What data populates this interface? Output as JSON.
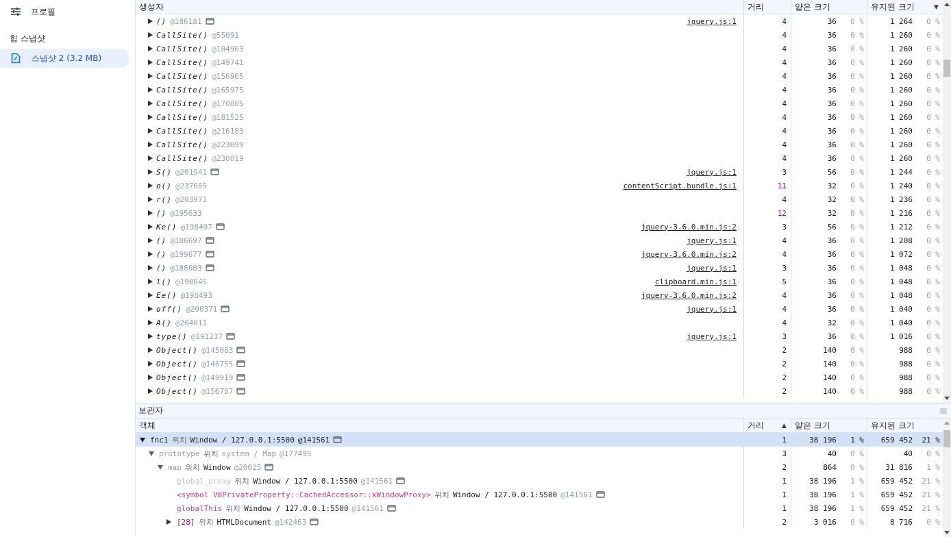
{
  "sidebar": {
    "title": "프로필",
    "section": "힙 스냅샷",
    "items": [
      {
        "label": "스냅샷 2 (3.2 MB)",
        "selected": true
      }
    ]
  },
  "constructors": {
    "columns": [
      {
        "label": "생성자"
      },
      {
        "label": "거리"
      },
      {
        "label": "얕은 크기"
      },
      {
        "label": "유지된 크기",
        "sort_mark": "▼"
      }
    ],
    "rows": [
      {
        "name": "()",
        "id": "@186181",
        "has_icon": true,
        "source": "jquery.js:1",
        "distance": "4",
        "far": false,
        "shallow": "36",
        "shallow_pct": "0 %",
        "retained": "1 264",
        "retained_pct": "0 %",
        "selected": false
      },
      {
        "name": "CallSite()",
        "id": "@55091",
        "has_icon": false,
        "distance": "4",
        "far": false,
        "shallow": "36",
        "shallow_pct": "0 %",
        "retained": "1 260",
        "retained_pct": "0 %",
        "selected": false
      },
      {
        "name": "CallSite()",
        "id": "@104903",
        "has_icon": false,
        "distance": "4",
        "far": false,
        "shallow": "36",
        "shallow_pct": "0 %",
        "retained": "1 260",
        "retained_pct": "0 %",
        "selected": false
      },
      {
        "name": "CallSite()",
        "id": "@149741",
        "has_icon": false,
        "distance": "4",
        "far": false,
        "shallow": "36",
        "shallow_pct": "0 %",
        "retained": "1 260",
        "retained_pct": "0 %",
        "selected": false
      },
      {
        "name": "CallSite()",
        "id": "@156965",
        "has_icon": false,
        "distance": "4",
        "far": false,
        "shallow": "36",
        "shallow_pct": "0 %",
        "retained": "1 260",
        "retained_pct": "0 %",
        "selected": false
      },
      {
        "name": "CallSite()",
        "id": "@165975",
        "has_icon": false,
        "distance": "4",
        "far": false,
        "shallow": "36",
        "shallow_pct": "0 %",
        "retained": "1 260",
        "retained_pct": "0 %",
        "selected": false
      },
      {
        "name": "CallSite()",
        "id": "@170805",
        "has_icon": false,
        "distance": "4",
        "far": false,
        "shallow": "36",
        "shallow_pct": "0 %",
        "retained": "1 260",
        "retained_pct": "0 %",
        "selected": false
      },
      {
        "name": "CallSite()",
        "id": "@181525",
        "has_icon": false,
        "distance": "4",
        "far": false,
        "shallow": "36",
        "shallow_pct": "0 %",
        "retained": "1 260",
        "retained_pct": "0 %",
        "selected": false
      },
      {
        "name": "CallSite()",
        "id": "@216183",
        "has_icon": false,
        "distance": "4",
        "far": false,
        "shallow": "36",
        "shallow_pct": "0 %",
        "retained": "1 260",
        "retained_pct": "0 %",
        "selected": false
      },
      {
        "name": "CallSite()",
        "id": "@223099",
        "has_icon": false,
        "distance": "4",
        "far": false,
        "shallow": "36",
        "shallow_pct": "0 %",
        "retained": "1 260",
        "retained_pct": "0 %",
        "selected": false
      },
      {
        "name": "CallSite()",
        "id": "@230019",
        "has_icon": false,
        "distance": "4",
        "far": false,
        "shallow": "36",
        "shallow_pct": "0 %",
        "retained": "1 260",
        "retained_pct": "0 %",
        "selected": false
      },
      {
        "name": "S()",
        "id": "@201941",
        "has_icon": true,
        "source": "jquery.js:1",
        "distance": "3",
        "far": false,
        "shallow": "56",
        "shallow_pct": "0 %",
        "retained": "1 244",
        "retained_pct": "0 %",
        "selected": false
      },
      {
        "name": "o()",
        "id": "@237665",
        "has_icon": false,
        "source": "contentScript.bundle.js:1",
        "distance": "11",
        "far": true,
        "shallow": "32",
        "shallow_pct": "0 %",
        "retained": "1 240",
        "retained_pct": "0 %",
        "selected": false
      },
      {
        "name": "r()",
        "id": "@203971",
        "has_icon": false,
        "distance": "4",
        "far": false,
        "shallow": "32",
        "shallow_pct": "0 %",
        "retained": "1 236",
        "retained_pct": "0 %",
        "selected": false
      },
      {
        "name": "()",
        "id": "@195633",
        "has_icon": false,
        "distance": "12",
        "far": true,
        "shallow": "32",
        "shallow_pct": "0 %",
        "retained": "1 216",
        "retained_pct": "0 %",
        "selected": false
      },
      {
        "name": "Ke()",
        "id": "@198497",
        "has_icon": true,
        "source": "jquery-3.6.0.min.js:2",
        "distance": "3",
        "far": false,
        "shallow": "56",
        "shallow_pct": "0 %",
        "retained": "1 212",
        "retained_pct": "0 %",
        "selected": false
      },
      {
        "name": "()",
        "id": "@186697",
        "has_icon": true,
        "source": "jquery.js:1",
        "distance": "4",
        "far": false,
        "shallow": "36",
        "shallow_pct": "0 %",
        "retained": "1 208",
        "retained_pct": "0 %",
        "selected": false
      },
      {
        "name": "()",
        "id": "@199677",
        "has_icon": true,
        "source": "jquery-3.6.0.min.js:2",
        "distance": "4",
        "far": false,
        "shallow": "36",
        "shallow_pct": "0 %",
        "retained": "1 072",
        "retained_pct": "0 %",
        "selected": false
      },
      {
        "name": "()",
        "id": "@186683",
        "has_icon": true,
        "source": "jquery.js:1",
        "distance": "3",
        "far": false,
        "shallow": "36",
        "shallow_pct": "0 %",
        "retained": "1 048",
        "retained_pct": "0 %",
        "selected": false
      },
      {
        "name": "l()",
        "id": "@198045",
        "has_icon": false,
        "source": "clipboard.min.js:1",
        "distance": "5",
        "far": false,
        "shallow": "36",
        "shallow_pct": "0 %",
        "retained": "1 048",
        "retained_pct": "0 %",
        "selected": false
      },
      {
        "name": "Ee()",
        "id": "@198493",
        "has_icon": false,
        "source": "jquery-3.6.0.min.js:2",
        "distance": "4",
        "far": false,
        "shallow": "36",
        "shallow_pct": "0 %",
        "retained": "1 048",
        "retained_pct": "0 %",
        "selected": false
      },
      {
        "name": "off()",
        "id": "@200371",
        "has_icon": true,
        "source": "jquery.js:1",
        "distance": "4",
        "far": false,
        "shallow": "36",
        "shallow_pct": "0 %",
        "retained": "1 040",
        "retained_pct": "0 %",
        "selected": false
      },
      {
        "name": "A()",
        "id": "@204011",
        "has_icon": false,
        "distance": "4",
        "far": false,
        "shallow": "32",
        "shallow_pct": "0 %",
        "retained": "1 040",
        "retained_pct": "0 %",
        "selected": false
      },
      {
        "name": "type()",
        "id": "@191237",
        "has_icon": true,
        "source": "jquery.js:1",
        "distance": "3",
        "far": false,
        "shallow": "36",
        "shallow_pct": "0 %",
        "retained": "1 016",
        "retained_pct": "0 %",
        "selected": false
      },
      {
        "name": "Object()",
        "id": "@145083",
        "has_icon": true,
        "distance": "2",
        "far": false,
        "shallow": "140",
        "shallow_pct": "0 %",
        "retained": "988",
        "retained_pct": "0 %",
        "selected": false
      },
      {
        "name": "Object()",
        "id": "@146755",
        "has_icon": true,
        "distance": "2",
        "far": false,
        "shallow": "140",
        "shallow_pct": "0 %",
        "retained": "988",
        "retained_pct": "0 %",
        "selected": false
      },
      {
        "name": "Object()",
        "id": "@149919",
        "has_icon": true,
        "distance": "2",
        "far": false,
        "shallow": "140",
        "shallow_pct": "0 %",
        "retained": "988",
        "retained_pct": "0 %",
        "selected": false
      },
      {
        "name": "Object()",
        "id": "@156787",
        "has_icon": true,
        "distance": "2",
        "far": false,
        "shallow": "140",
        "shallow_pct": "0 %",
        "retained": "988",
        "retained_pct": "0 %",
        "selected": false
      }
    ]
  },
  "retainers": {
    "title": "보관자",
    "columns": [
      {
        "label": "객체"
      },
      {
        "label": "거리",
        "sort_mark": "▲"
      },
      {
        "label": "얕은 크기"
      },
      {
        "label": "유지된 크기"
      }
    ],
    "rows": [
      {
        "name": "fnc1",
        "color": "#202124",
        "dimmed": false,
        "in": "위치",
        "class_name": "Window / 127.0.0.1:5500",
        "id": "@141561",
        "has_icon": true,
        "distance": "1",
        "shallow": "38 196",
        "shallow_pct": "1 %",
        "retained": "659 452",
        "retained_pct": "21 %",
        "expanded": true,
        "selected": true,
        "children": [
          {
            "name": "prototype",
            "color": "#9aa0a6",
            "dimmed": true,
            "in": "위치",
            "class_name": "system / Map",
            "id": "@177495",
            "has_icon": false,
            "distance": "3",
            "shallow": "40",
            "shallow_pct": "0 %",
            "retained": "40",
            "retained_pct": "0 %",
            "expanded": true,
            "selected": false,
            "children": [
              {
                "name": "map",
                "color": "#9aa0a6",
                "dimmed": false,
                "in": "위치",
                "class_name": "Window",
                "id": "@20025",
                "has_icon": true,
                "distance": "2",
                "shallow": "864",
                "shallow_pct": "0 %",
                "retained": "31 816",
                "retained_pct": "1 %",
                "expanded": true,
                "selected": false,
                "children": [
                  {
                    "name": "global_proxy",
                    "color": "#bdc1c6",
                    "dimmed": false,
                    "in": "위치",
                    "class_name": "Window / 127.0.0.1:5500",
                    "id": "@141561",
                    "has_icon": true,
                    "distance": "1",
                    "shallow": "38 196",
                    "shallow_pct": "1 %",
                    "retained": "659 452",
                    "retained_pct": "21 %",
                    "selected": false
                  },
                  {
                    "name": "<symbol V8PrivateProperty::CachedAccessor::kWindowProxy>",
                    "color": "#c2477f",
                    "dimmed": false,
                    "in": "위치",
                    "class_name": "Window / 127.0.0.1:5500",
                    "id": "@141561",
                    "has_icon": true,
                    "distance": "1",
                    "shallow": "38 196",
                    "shallow_pct": "1 %",
                    "retained": "659 452",
                    "retained_pct": "21 %",
                    "selected": false
                  },
                  {
                    "name": "globalThis",
                    "color": "#c2477f",
                    "dimmed": false,
                    "in": "위치",
                    "class_name": "Window / 127.0.0.1:5500",
                    "id": "@141561",
                    "has_icon": true,
                    "distance": "1",
                    "shallow": "38 196",
                    "shallow_pct": "1 %",
                    "retained": "659 452",
                    "retained_pct": "21 %",
                    "selected": false
                  },
                  {
                    "name": "[28]",
                    "color": "#881280",
                    "dimmed": false,
                    "in": "위치",
                    "class_name": "HTMLDocument",
                    "id": "@142463",
                    "has_icon": true,
                    "distance": "2",
                    "shallow": "3 016",
                    "shallow_pct": "0 %",
                    "retained": "8 716",
                    "retained_pct": "0 %",
                    "expanded": false,
                    "selected": false
                  }
                ]
              }
            ]
          }
        ]
      }
    ]
  }
}
